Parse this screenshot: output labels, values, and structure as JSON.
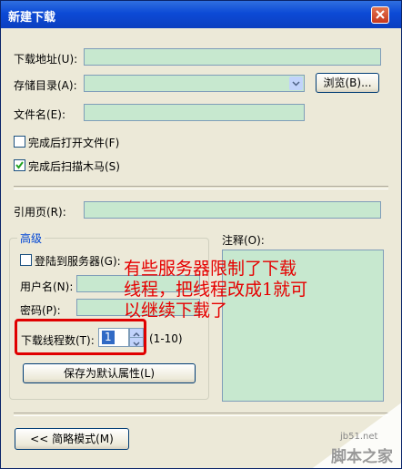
{
  "window": {
    "title": "新建下载"
  },
  "form": {
    "url_label": "下载地址(U):",
    "dir_label": "存储目录(A):",
    "browse_label": "浏览(B)...",
    "filename_label": "文件名(E):",
    "open_after_label": "完成后打开文件(F)",
    "scan_after_label": "完成后扫描木马(S)",
    "referrer_label": "引用页(R):",
    "notes_label": "注释(O):"
  },
  "advanced": {
    "group_label": "高级",
    "login_label": "登陆到服务器(G):",
    "username_label": "用户名(N):",
    "password_label": "密码(P):",
    "threads_label": "下载线程数(T):",
    "threads_value": "1",
    "threads_range": "(1-10)",
    "save_default_label": "保存为默认属性(L)"
  },
  "footer": {
    "simple_mode_label": "<< 简略模式(M)"
  },
  "annotation": {
    "line1": "有些服务器限制了下载",
    "line2": "线程，把线程改成1就可",
    "line3": "以继续下载了"
  },
  "watermark": {
    "site": "jb51.net",
    "name": "脚本之家"
  },
  "colors": {
    "title_bar": "#0c4ad6",
    "field_bg": "#c7e8cf",
    "annotation": "#e00000",
    "dialog_bg": "#ece9d8"
  }
}
